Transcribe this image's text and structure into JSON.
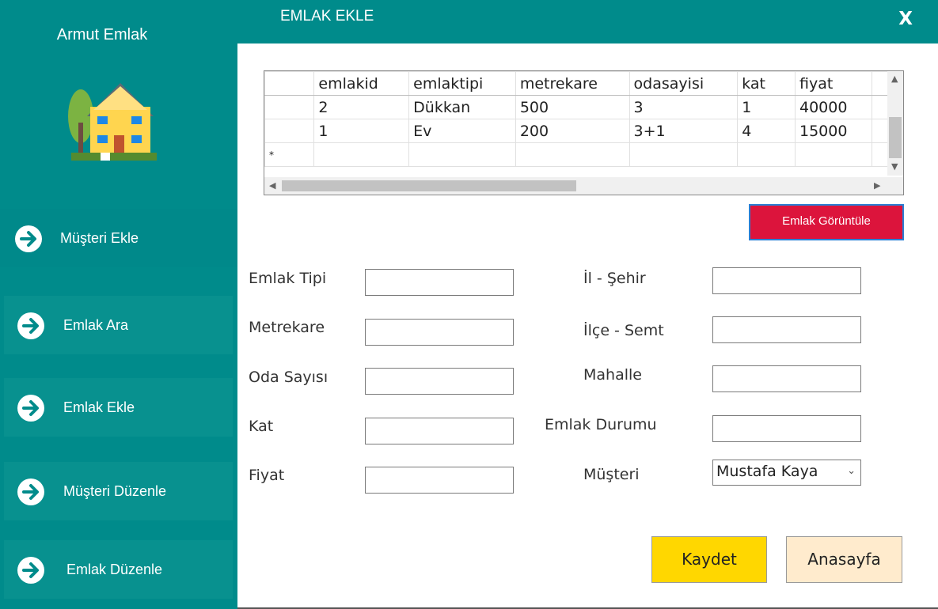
{
  "app": {
    "name": "Armut Emlak"
  },
  "sidebar": {
    "items": [
      {
        "label": "Müşteri Ekle",
        "icon": "arrow-right-circle-icon"
      },
      {
        "label": "Emlak Ara",
        "icon": "arrow-right-circle-icon"
      },
      {
        "label": "Emlak Ekle",
        "icon": "arrow-right-circle-icon"
      },
      {
        "label": "Müşteri Düzenle",
        "icon": "arrow-right-circle-icon"
      },
      {
        "label": "Emlak Düzenle",
        "icon": "arrow-right-circle-icon"
      }
    ]
  },
  "header": {
    "title": "EMLAK EKLE",
    "close": "X"
  },
  "grid": {
    "columns": [
      "emlakid",
      "emlaktipi",
      "metrekare",
      "odasayisi",
      "kat",
      "fiyat"
    ],
    "rows": [
      [
        "2",
        "Dükkan",
        "500",
        "3",
        "1",
        "40000"
      ],
      [
        "1",
        "Ev",
        "200",
        "3+1",
        "4",
        "15000"
      ]
    ],
    "new_row_marker": "*"
  },
  "buttons": {
    "view": "Emlak Görüntüle",
    "save": "Kaydet",
    "home": "Anasayfa"
  },
  "form": {
    "left": {
      "type": "Emlak Tipi",
      "area": "Metrekare",
      "rooms": "Oda Sayısı",
      "floor": "Kat",
      "price": "Fiyat"
    },
    "right": {
      "city": "İl - Şehir",
      "district": "İlçe - Semt",
      "neighborhood": "Mahalle",
      "status": "Emlak Durumu",
      "customer": "Müşteri"
    },
    "customer_selected": "Mustafa Kaya"
  },
  "colors": {
    "teal": "#008b8b",
    "view_button": "#dc143c",
    "save_button": "#ffd700",
    "home_button": "#ffebcd"
  }
}
